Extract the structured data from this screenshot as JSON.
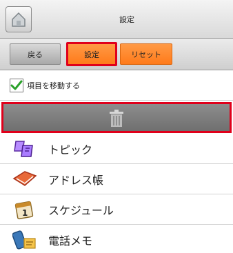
{
  "header": {
    "title": "設定",
    "home_icon": "home-icon"
  },
  "toolbar": {
    "back_label": "戻る",
    "settings_label": "設定",
    "reset_label": "リセット"
  },
  "options": {
    "move_items_label": "項目を移動する",
    "move_items_checked": true
  },
  "trash": {
    "icon": "trash-icon"
  },
  "list": {
    "items": [
      {
        "label": "トピック",
        "icon": "topics-icon"
      },
      {
        "label": "アドレス帳",
        "icon": "address-book-icon"
      },
      {
        "label": "スケジュール",
        "icon": "calendar-icon"
      },
      {
        "label": "電話メモ",
        "icon": "phone-memo-icon"
      }
    ]
  },
  "colors": {
    "accent": "#ff8a2a",
    "highlight": "#e0001b",
    "check": "#2aa12a"
  }
}
